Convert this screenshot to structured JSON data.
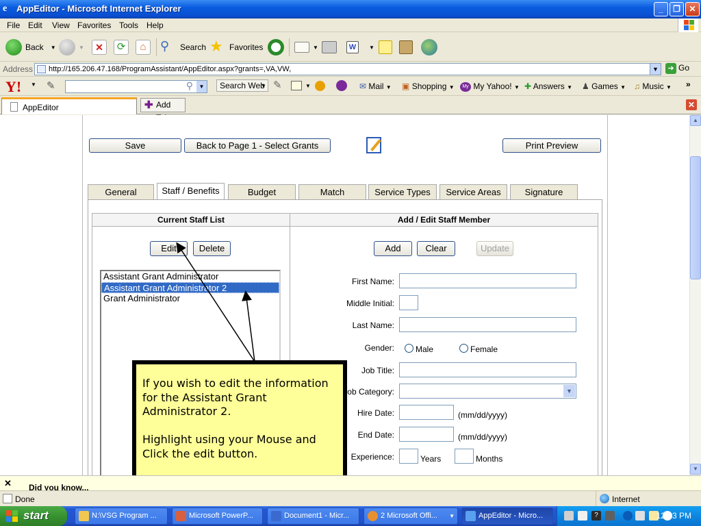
{
  "window": {
    "title": "AppEditor - Microsoft Internet Explorer",
    "controls": [
      "_",
      "❐",
      "✕"
    ]
  },
  "menu": [
    "File",
    "Edit",
    "View",
    "Favorites",
    "Tools",
    "Help"
  ],
  "toolbar": {
    "back": "Back",
    "search": "Search",
    "favorites": "Favorites"
  },
  "address": {
    "label": "Address",
    "url": "http://165.206.47.168/ProgramAssistant/AppEditor.aspx?grants=,VA,VW,",
    "go": "Go"
  },
  "yahoo": {
    "logo": "Y!",
    "search_web": "Search Web",
    "items": [
      "Mail",
      "Shopping",
      "My Yahoo!",
      "Answers",
      "Games",
      "Music"
    ],
    "more": "»"
  },
  "tabs_bar": {
    "current_tab": "AppEditor",
    "add_tab": "Add Tab"
  },
  "page": {
    "save": "Save",
    "back_page1": "Back to Page 1 - Select Grants",
    "print_preview": "Print Preview",
    "tabs": [
      "General",
      "Staff / Benefits",
      "Budget",
      "Match",
      "Service Types",
      "Service Areas",
      "Signature"
    ],
    "active_tab": "Staff / Benefits",
    "current_staff_header": "Current Staff List",
    "add_edit_header": "Add / Edit Staff Member",
    "edit": "Edit",
    "delete": "Delete",
    "add": "Add",
    "clear": "Clear",
    "update": "Update",
    "staff_list": [
      "Assistant Grant Administrator",
      "Assistant Grant Administrator 2",
      "Grant Administrator"
    ],
    "selected_index": 1,
    "form": {
      "first_name": "First Name:",
      "middle_initial": "Middle Initial:",
      "last_name": "Last Name:",
      "gender": "Gender:",
      "male": "Male",
      "female": "Female",
      "job_title": "Job Title:",
      "job_category": "Job Category:",
      "hire_date": "Hire Date:",
      "end_date": "End Date:",
      "date_hint": "(mm/dd/yyyy)",
      "experience": "Experience:",
      "years": "Years",
      "months": "Months"
    }
  },
  "callout": {
    "text": "If you wish to edit the information for the Assistant Grant Administrator 2.\n\nHighlight using your Mouse and Click the edit button."
  },
  "infobar": {
    "close": "✕",
    "text": "Did you know..."
  },
  "status": {
    "left": "Done",
    "zone": "Internet"
  },
  "taskbar": {
    "start": "start",
    "tasks": [
      "N:\\VSG Program ...",
      "Microsoft PowerP...",
      "Document1 - Micr...",
      "2 Microsoft Offi...",
      "AppEditor - Micro..."
    ],
    "clock": "12:13 PM"
  }
}
